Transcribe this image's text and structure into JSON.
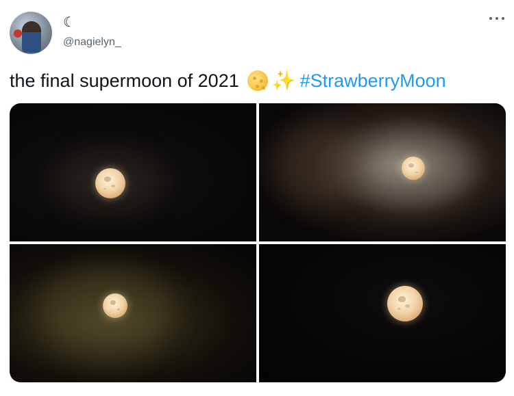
{
  "tweet": {
    "display_name": "☾",
    "handle": "@nagielyn_",
    "text": "the final supermoon of 2021",
    "hashtag": "#StrawberryMoon",
    "emojis": [
      "full-moon-emoji",
      "sparkles-emoji"
    ]
  },
  "media": {
    "photos": [
      {
        "name": "moon-photo-1"
      },
      {
        "name": "moon-photo-2"
      },
      {
        "name": "moon-photo-3"
      },
      {
        "name": "moon-photo-4"
      }
    ]
  },
  "icons": {
    "more": "more-options-icon",
    "sparkles": "✨"
  },
  "colors": {
    "link": "#1d9bf0",
    "secondary_text": "#536471",
    "primary_text": "#0f1419"
  }
}
